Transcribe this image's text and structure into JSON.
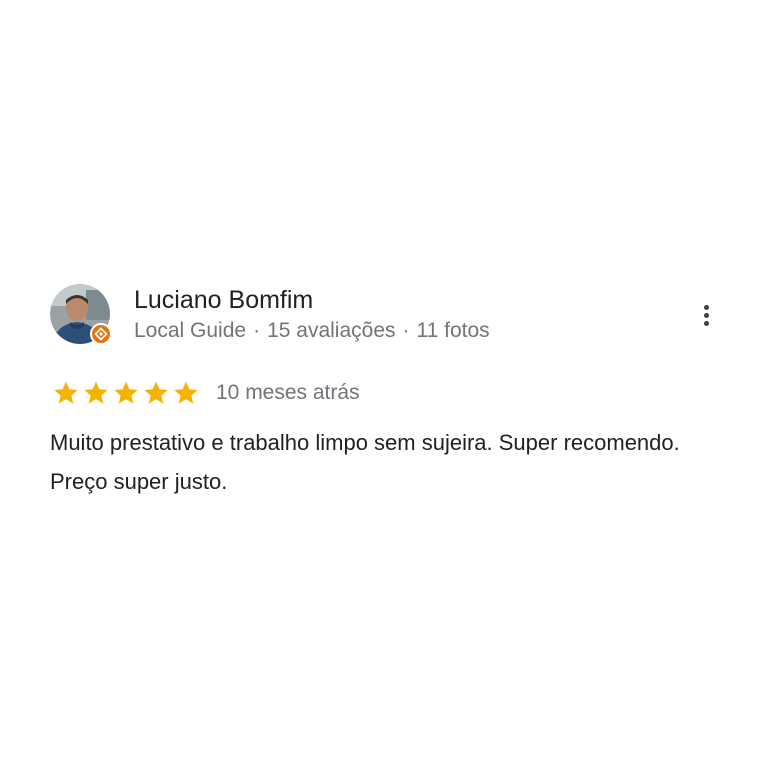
{
  "review": {
    "author": {
      "name": "Luciano Bomfim",
      "badge_icon": "local-guide-badge-icon",
      "meta": {
        "role": "Local Guide",
        "separator": "·",
        "reviews": "15 avaliações",
        "photos": "11 fotos"
      }
    },
    "rating": {
      "value": 5,
      "max": 5,
      "star_color": "#f5b301"
    },
    "time_ago": "10 meses atrás",
    "text": "Muito prestativo e trabalho limpo sem sujeira. Super recomendo. Preço super justo.",
    "menu_icon": "more-vert-icon"
  },
  "colors": {
    "primary_text": "#202124",
    "secondary_text": "#70757a",
    "badge": "#e8710a"
  }
}
